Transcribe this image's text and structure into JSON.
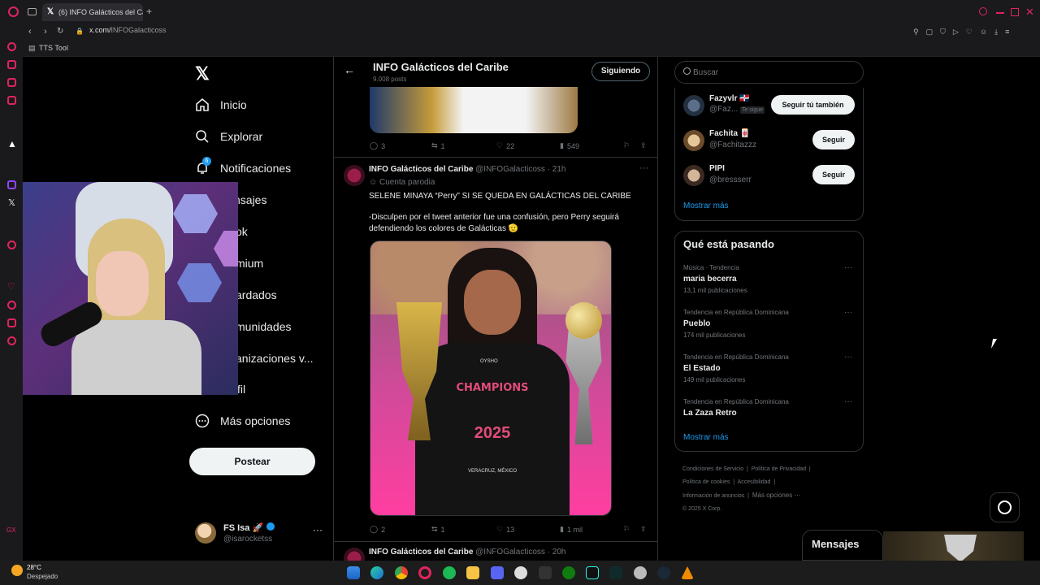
{
  "browser": {
    "tab_title": "(6) INFO Galácticos del Ca",
    "url_prefix": "x.com/",
    "url_path": "INFOGalacticoss",
    "bookmark": "TTS Tool"
  },
  "nav": {
    "items": [
      "Inicio",
      "Explorar",
      "Notificaciones",
      "nsajes",
      "ok",
      "mium",
      "ardados",
      "munidades",
      "anizaciones v...",
      "fil",
      "Más opciones"
    ],
    "notif_badge": "6",
    "post_button": "Postear",
    "user_name": "FS Isa 🚀",
    "user_handle": "@isarocketss"
  },
  "profile_header": {
    "name": "INFO Galácticos del Caribe",
    "posts": "9.008 posts",
    "follow_button": "Siguiendo"
  },
  "tweet_prev_actions": {
    "replies": "3",
    "retweets": "1",
    "likes": "22",
    "views": "549"
  },
  "tweet": {
    "author": "INFO Galácticos del Caribe",
    "handle": "@INFOGalacticoss · 21h",
    "parody": "Cuenta parodia",
    "line1": "SELENE MINAYA “Perry” SI SE QUEDA EN GALÁCTICAS DEL CARIBE",
    "line2": "-Disculpen por el tweet anterior fue una confusión, pero Perry seguirá defendiendo los colores de Galácticas 🫡",
    "shirt_brand": "OYSHO",
    "shirt_text": "CHAMPIONS",
    "shirt_year": "2025",
    "shirt_city": "VERACRUZ, MÉXICO",
    "replies": "2",
    "retweets": "1",
    "likes": "13",
    "views": "1 mil"
  },
  "tweet_next": {
    "author": "INFO Galácticos del Caribe",
    "handle": "@INFOGalacticoss · 20h"
  },
  "search": {
    "placeholder": "Buscar"
  },
  "who_to_follow": {
    "items": [
      {
        "name": "Fazyvlr 🇩🇴",
        "handle": "@Faz...",
        "tag": "Te sigue",
        "button": "Seguir tú también"
      },
      {
        "name": "Fachita 🀄",
        "handle": "@Fachitazzz",
        "tag": "",
        "button": "Seguir"
      },
      {
        "name": "PIPI",
        "handle": "@bressserr",
        "tag": "",
        "button": "Seguir"
      }
    ],
    "show_more": "Mostrar más"
  },
  "trends": {
    "title": "Qué está pasando",
    "items": [
      {
        "context": "Música · Tendencia",
        "name": "maria becerra",
        "count": "13,1 mil publicaciones"
      },
      {
        "context": "Tendencia en República Dominicana",
        "name": "Pueblo",
        "count": "174 mil publicaciones"
      },
      {
        "context": "Tendencia en República Dominicana",
        "name": "El Estado",
        "count": "149 mil publicaciones"
      },
      {
        "context": "Tendencia en República Dominicana",
        "name": "La Zaza Retro",
        "count": ""
      }
    ],
    "show_more": "Mostrar más"
  },
  "footer": {
    "links": [
      "Condiciones de Servicio",
      "Política de Privacidad",
      "Política de cookies",
      "Accesibilidad",
      "Información de anuncios",
      "Más opciones ···"
    ],
    "copyright": "© 2025 X Corp."
  },
  "messages_label": "Mensajes",
  "weather": {
    "temp": "28°C",
    "cond": "Despejado"
  },
  "colors": {
    "accent": "#1d9bf0",
    "background": "#000000",
    "border": "#2f3336",
    "opera_red": "#e0245e"
  }
}
